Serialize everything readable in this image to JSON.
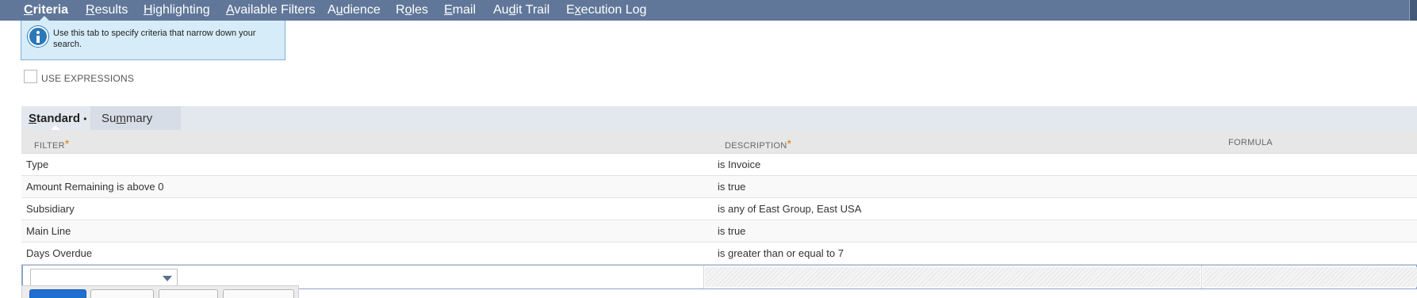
{
  "tabs": [
    {
      "pre": "",
      "key": "C",
      "post": "riteria",
      "active": true
    },
    {
      "pre": "",
      "key": "R",
      "post": "esults",
      "active": false
    },
    {
      "pre": "",
      "key": "H",
      "post": "ighlighting",
      "active": false
    },
    {
      "pre": "",
      "key": "A",
      "post": "vailable Filters",
      "active": false
    },
    {
      "pre": "A",
      "key": "u",
      "post": "dience",
      "active": false
    },
    {
      "pre": "R",
      "key": "o",
      "post": "les",
      "active": false
    },
    {
      "pre": "",
      "key": "E",
      "post": "mail",
      "active": false
    },
    {
      "pre": "Au",
      "key": "d",
      "post": "it Trail",
      "active": false
    },
    {
      "pre": "E",
      "key": "x",
      "post": "ecution Log",
      "active": false
    }
  ],
  "info": {
    "text": "Use this tab to specify criteria that narrow down your search.",
    "icon": "info-icon"
  },
  "use_expressions": {
    "label": "USE EXPRESSIONS",
    "checked": false
  },
  "subtabs": {
    "standard": {
      "key": "S",
      "post": "tandard",
      "dot": "•"
    },
    "summary": {
      "pre": "Su",
      "key": "m",
      "post": "mary"
    }
  },
  "grid": {
    "headers": {
      "filter": "FILTER",
      "description": "DESCRIPTION",
      "formula": "FORMULA",
      "required_mark": "*"
    },
    "rows": [
      {
        "filter": "Type",
        "description": "is Invoice"
      },
      {
        "filter": "Amount Remaining is above 0",
        "description": "is true"
      },
      {
        "filter": "Subsidiary",
        "description": "is any of East Group, East USA"
      },
      {
        "filter": "Main Line",
        "description": "is true"
      },
      {
        "filter": "Days Overdue",
        "description": "is greater than or equal to 7"
      }
    ],
    "new_row_select_value": ""
  },
  "colors": {
    "topbar": "#607799",
    "info_bg": "#d6ecf8",
    "required": "#e67a00",
    "primary_button": "#1e6fd0"
  }
}
